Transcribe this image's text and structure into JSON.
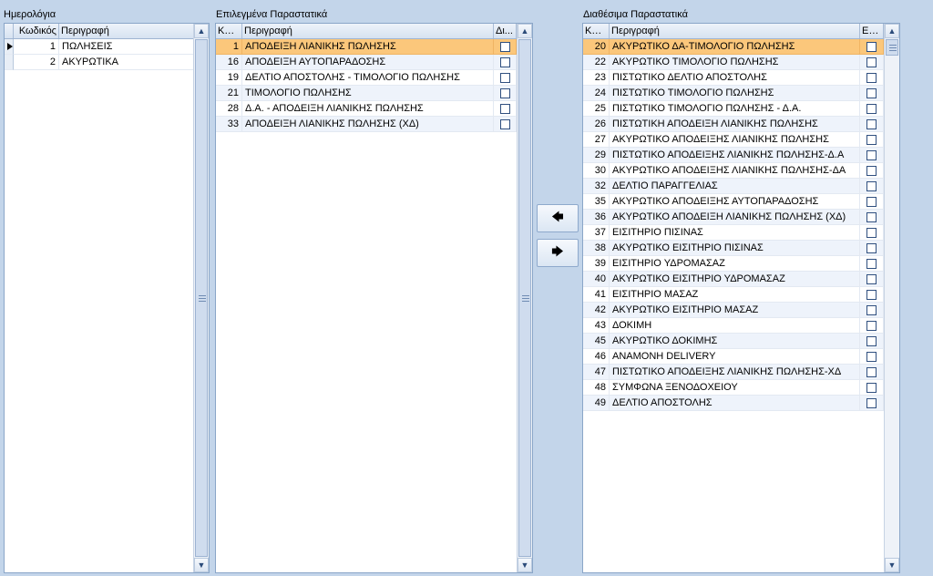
{
  "calendars": {
    "title": "Ημερολόγια",
    "columns": [
      "Κωδικός",
      "Περιγραφή"
    ],
    "rows": [
      {
        "code": "1",
        "desc": "ΠΩΛΗΣΕΙΣ"
      },
      {
        "code": "2",
        "desc": "ΑΚΥΡΩΤΙΚΑ"
      }
    ]
  },
  "selected_docs": {
    "title": "Επιλεγμένα Παραστατικά",
    "columns": [
      "Κω...",
      "Περιγραφή",
      "Δι..."
    ],
    "rows": [
      {
        "code": "1",
        "desc": "ΑΠΟΔΕΙΞΗ ΛΙΑΝΙΚΗΣ ΠΩΛΗΣΗΣ",
        "checked": false
      },
      {
        "code": "16",
        "desc": "ΑΠΟΔΕΙΞΗ ΑΥΤΟΠΑΡΑΔΟΣΗΣ",
        "checked": false
      },
      {
        "code": "19",
        "desc": "ΔΕΛΤΙΟ ΑΠΟΣΤΟΛΗΣ - ΤΙΜΟΛΟΓΙΟ ΠΩΛΗΣΗΣ",
        "checked": false
      },
      {
        "code": "21",
        "desc": "ΤΙΜΟΛΟΓΙΟ ΠΩΛΗΣΗΣ",
        "checked": false
      },
      {
        "code": "28",
        "desc": "Δ.Α. - ΑΠΟΔΕΙΞΗ ΛΙΑΝΙΚΗΣ ΠΩΛΗΣΗΣ",
        "checked": false
      },
      {
        "code": "33",
        "desc": "ΑΠΟΔΕΙΞΗ ΛΙΑΝΙΚΗΣ ΠΩΛΗΣΗΣ (ΧΔ)",
        "checked": false
      }
    ]
  },
  "available_docs": {
    "title": "Διαθέσιμα Παραστατικά",
    "columns": [
      "Κω...",
      "Περιγραφή",
      "Επ..."
    ],
    "rows": [
      {
        "code": "20",
        "desc": "ΑΚΥΡΩΤΙΚΟ ΔΑ-ΤΙΜΟΛΟΓΙΟ ΠΩΛΗΣΗΣ",
        "checked": false
      },
      {
        "code": "22",
        "desc": "ΑΚΥΡΩΤΙΚΟ ΤΙΜΟΛΟΓΙΟ ΠΩΛΗΣΗΣ",
        "checked": false
      },
      {
        "code": "23",
        "desc": "ΠΙΣΤΩΤΙΚΟ ΔΕΛΤΙΟ ΑΠΟΣΤΟΛΗΣ",
        "checked": false
      },
      {
        "code": "24",
        "desc": "ΠΙΣΤΩΤΙΚΟ ΤΙΜΟΛΟΓΙΟ ΠΩΛΗΣΗΣ",
        "checked": false
      },
      {
        "code": "25",
        "desc": "ΠΙΣΤΩΤΙΚΟ ΤΙΜΟΛΟΓΙΟ ΠΩΛΗΣΗΣ - Δ.Α.",
        "checked": false
      },
      {
        "code": "26",
        "desc": "ΠΙΣΤΩΤΙΚΗ ΑΠΟΔΕΙΞΗ ΛΙΑΝΙΚΗΣ ΠΩΛΗΣΗΣ",
        "checked": false
      },
      {
        "code": "27",
        "desc": "ΑΚΥΡΩΤΙΚΟ ΑΠΟΔΕΙΞΗΣ ΛΙΑΝΙΚΗΣ ΠΩΛΗΣΗΣ",
        "checked": false
      },
      {
        "code": "29",
        "desc": "ΠΙΣΤΩΤΙΚΟ ΑΠΟΔΕΙΞΗΣ ΛΙΑΝΙΚΗΣ ΠΩΛΗΣΗΣ-Δ.Α",
        "checked": false
      },
      {
        "code": "30",
        "desc": "ΑΚΥΡΩΤΙΚΟ ΑΠΟΔΕΙΞΗΣ ΛΙΑΝΙΚΗΣ ΠΩΛΗΣΗΣ-ΔΑ",
        "checked": false
      },
      {
        "code": "32",
        "desc": "ΔΕΛΤΙΟ ΠΑΡΑΓΓΕΛΙΑΣ",
        "checked": false
      },
      {
        "code": "35",
        "desc": "ΑΚΥΡΩΤΙΚΟ ΑΠΟΔΕΙΞΗΣ ΑΥΤΟΠΑΡΑΔΟΣΗΣ",
        "checked": false
      },
      {
        "code": "36",
        "desc": "ΑΚΥΡΩΤΙΚΟ ΑΠΟΔΕΙΞΗ ΛΙΑΝΙΚΗΣ ΠΩΛΗΣΗΣ (ΧΔ)",
        "checked": false
      },
      {
        "code": "37",
        "desc": "ΕΙΣΙΤΗΡΙΟ ΠΙΣΙΝΑΣ",
        "checked": false
      },
      {
        "code": "38",
        "desc": "ΑΚΥΡΩΤΙΚΟ ΕΙΣΙΤΗΡΙΟ ΠΙΣΙΝΑΣ",
        "checked": false
      },
      {
        "code": "39",
        "desc": "ΕΙΣΙΤΗΡΙΟ ΥΔΡΟΜΑΣΑΖ",
        "checked": false
      },
      {
        "code": "40",
        "desc": "ΑΚΥΡΩΤΙΚΟ ΕΙΣΙΤΗΡΙΟ ΥΔΡΟΜΑΣΑΖ",
        "checked": false
      },
      {
        "code": "41",
        "desc": "ΕΙΣΙΤΗΡΙΟ ΜΑΣΑΖ",
        "checked": false
      },
      {
        "code": "42",
        "desc": "ΑΚΥΡΩΤΙΚΟ ΕΙΣΙΤΗΡΙΟ ΜΑΣΑΖ",
        "checked": false
      },
      {
        "code": "43",
        "desc": "ΔΟΚΙΜΗ",
        "checked": false
      },
      {
        "code": "45",
        "desc": "ΑΚΥΡΩΤΙΚΟ ΔΟΚΙΜΗΣ",
        "checked": false
      },
      {
        "code": "46",
        "desc": "ΑΝΑΜΟΝΗ DELIVERY",
        "checked": false
      },
      {
        "code": "47",
        "desc": "ΠΙΣΤΩΤΙΚΟ ΑΠΟΔΕΙΞΗΣ ΛΙΑΝΙΚΗΣ ΠΩΛΗΣΗΣ-ΧΔ",
        "checked": false
      },
      {
        "code": "48",
        "desc": "ΣΥΜΦΩΝΑ ΞΕΝΟΔΟΧΕΙΟΥ",
        "checked": false
      },
      {
        "code": "49",
        "desc": "ΔΕΛΤΙΟ ΑΠΟΣΤΟΛΗΣ",
        "checked": false
      }
    ]
  },
  "buttons": {
    "move_left_icon": "arrow-left-icon",
    "move_right_icon": "arrow-right-icon"
  },
  "colors": {
    "background": "#c3d5ea",
    "selected_row": "#fbc77b",
    "grid_border": "#8aa6c8"
  }
}
